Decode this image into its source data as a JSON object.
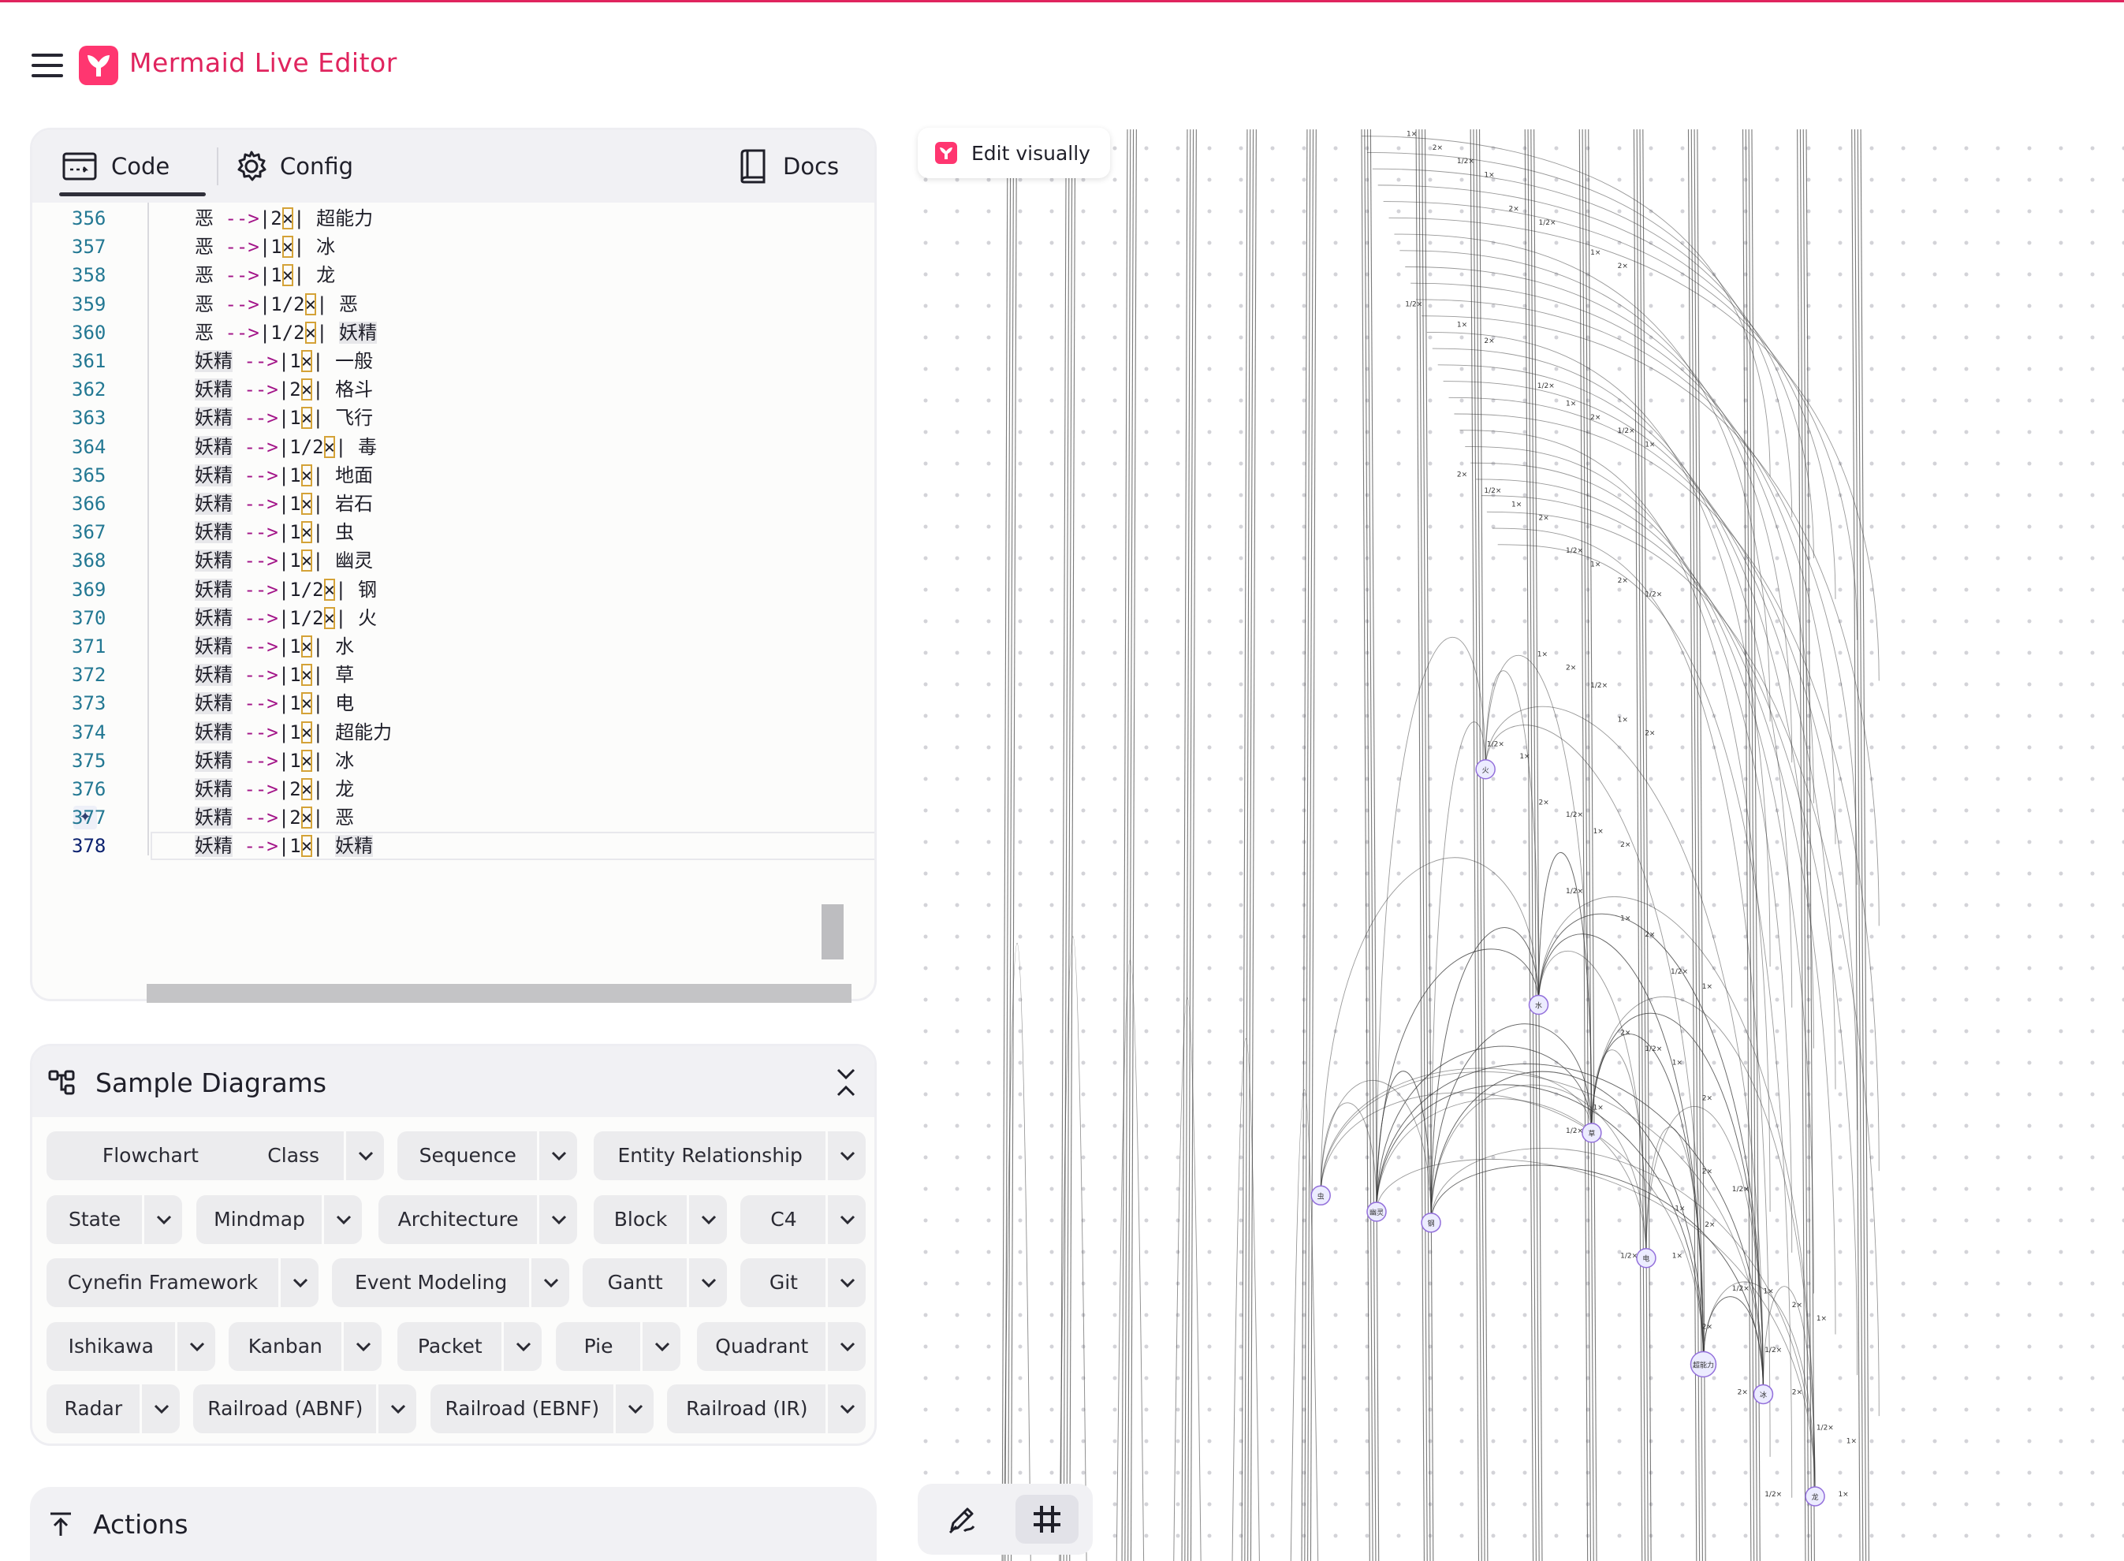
{
  "app": {
    "title": "Mermaid Live Editor"
  },
  "editor": {
    "tabs": {
      "code": "Code",
      "config": "Config",
      "docs": "Docs"
    },
    "lines": [
      {
        "n": "356",
        "src": "恶",
        "mid": "2",
        "dst": "超能力"
      },
      {
        "n": "357",
        "src": "恶",
        "mid": "1",
        "dst": "冰"
      },
      {
        "n": "358",
        "src": "恶",
        "mid": "1",
        "dst": "龙"
      },
      {
        "n": "359",
        "src": "恶",
        "mid": "1/2",
        "dst": "恶"
      },
      {
        "n": "360",
        "src": "恶",
        "mid": "1/2",
        "dst": "妖精"
      },
      {
        "n": "361",
        "src": "妖精",
        "mid": "1",
        "dst": "一般"
      },
      {
        "n": "362",
        "src": "妖精",
        "mid": "2",
        "dst": "格斗"
      },
      {
        "n": "363",
        "src": "妖精",
        "mid": "1",
        "dst": "飞行"
      },
      {
        "n": "364",
        "src": "妖精",
        "mid": "1/2",
        "dst": "毒"
      },
      {
        "n": "365",
        "src": "妖精",
        "mid": "1",
        "dst": "地面"
      },
      {
        "n": "366",
        "src": "妖精",
        "mid": "1",
        "dst": "岩石"
      },
      {
        "n": "367",
        "src": "妖精",
        "mid": "1",
        "dst": "虫"
      },
      {
        "n": "368",
        "src": "妖精",
        "mid": "1",
        "dst": "幽灵"
      },
      {
        "n": "369",
        "src": "妖精",
        "mid": "1/2",
        "dst": "钢"
      },
      {
        "n": "370",
        "src": "妖精",
        "mid": "1/2",
        "dst": "火"
      },
      {
        "n": "371",
        "src": "妖精",
        "mid": "1",
        "dst": "水"
      },
      {
        "n": "372",
        "src": "妖精",
        "mid": "1",
        "dst": "草"
      },
      {
        "n": "373",
        "src": "妖精",
        "mid": "1",
        "dst": "电"
      },
      {
        "n": "374",
        "src": "妖精",
        "mid": "1",
        "dst": "超能力"
      },
      {
        "n": "375",
        "src": "妖精",
        "mid": "1",
        "dst": "冰"
      },
      {
        "n": "376",
        "src": "妖精",
        "mid": "2",
        "dst": "龙"
      },
      {
        "n": "377",
        "src": "妖精",
        "mid": "2",
        "dst": "恶"
      },
      {
        "n": "378",
        "src": "妖精",
        "mid": "1",
        "dst": "妖精"
      }
    ],
    "arrow": "-->",
    "times": "×",
    "sparkle": "✦"
  },
  "samples": {
    "title": "Sample Diagrams",
    "rows": [
      [
        "Flowchart",
        "Class",
        "Sequence",
        "Entity Relationship"
      ],
      [
        "State",
        "Mindmap",
        "Architecture",
        "Block",
        "C4"
      ],
      [
        "Cynefin Framework",
        "Event Modeling",
        "Gantt",
        "Git"
      ],
      [
        "Ishikawa",
        "Kanban",
        "Packet",
        "Pie",
        "Quadrant"
      ],
      [
        "Radar",
        "Railroad (ABNF)",
        "Railroad (EBNF)",
        "Railroad (IR)"
      ]
    ]
  },
  "actions": {
    "title": "Actions"
  },
  "diagram": {
    "edit_visually": "Edit visually",
    "node_labels": [
      "虫",
      "幽灵",
      "钢",
      "火",
      "水",
      "草",
      "电",
      "超能力",
      "冰",
      "龙"
    ],
    "edge_labels": [
      "1×",
      "2×",
      "1/2×"
    ]
  },
  "colors": {
    "brand": "#e0245e",
    "logo": "#ff3670",
    "arrow": "#a31589",
    "line_number": "#237893",
    "match_box": "#d4a237"
  }
}
